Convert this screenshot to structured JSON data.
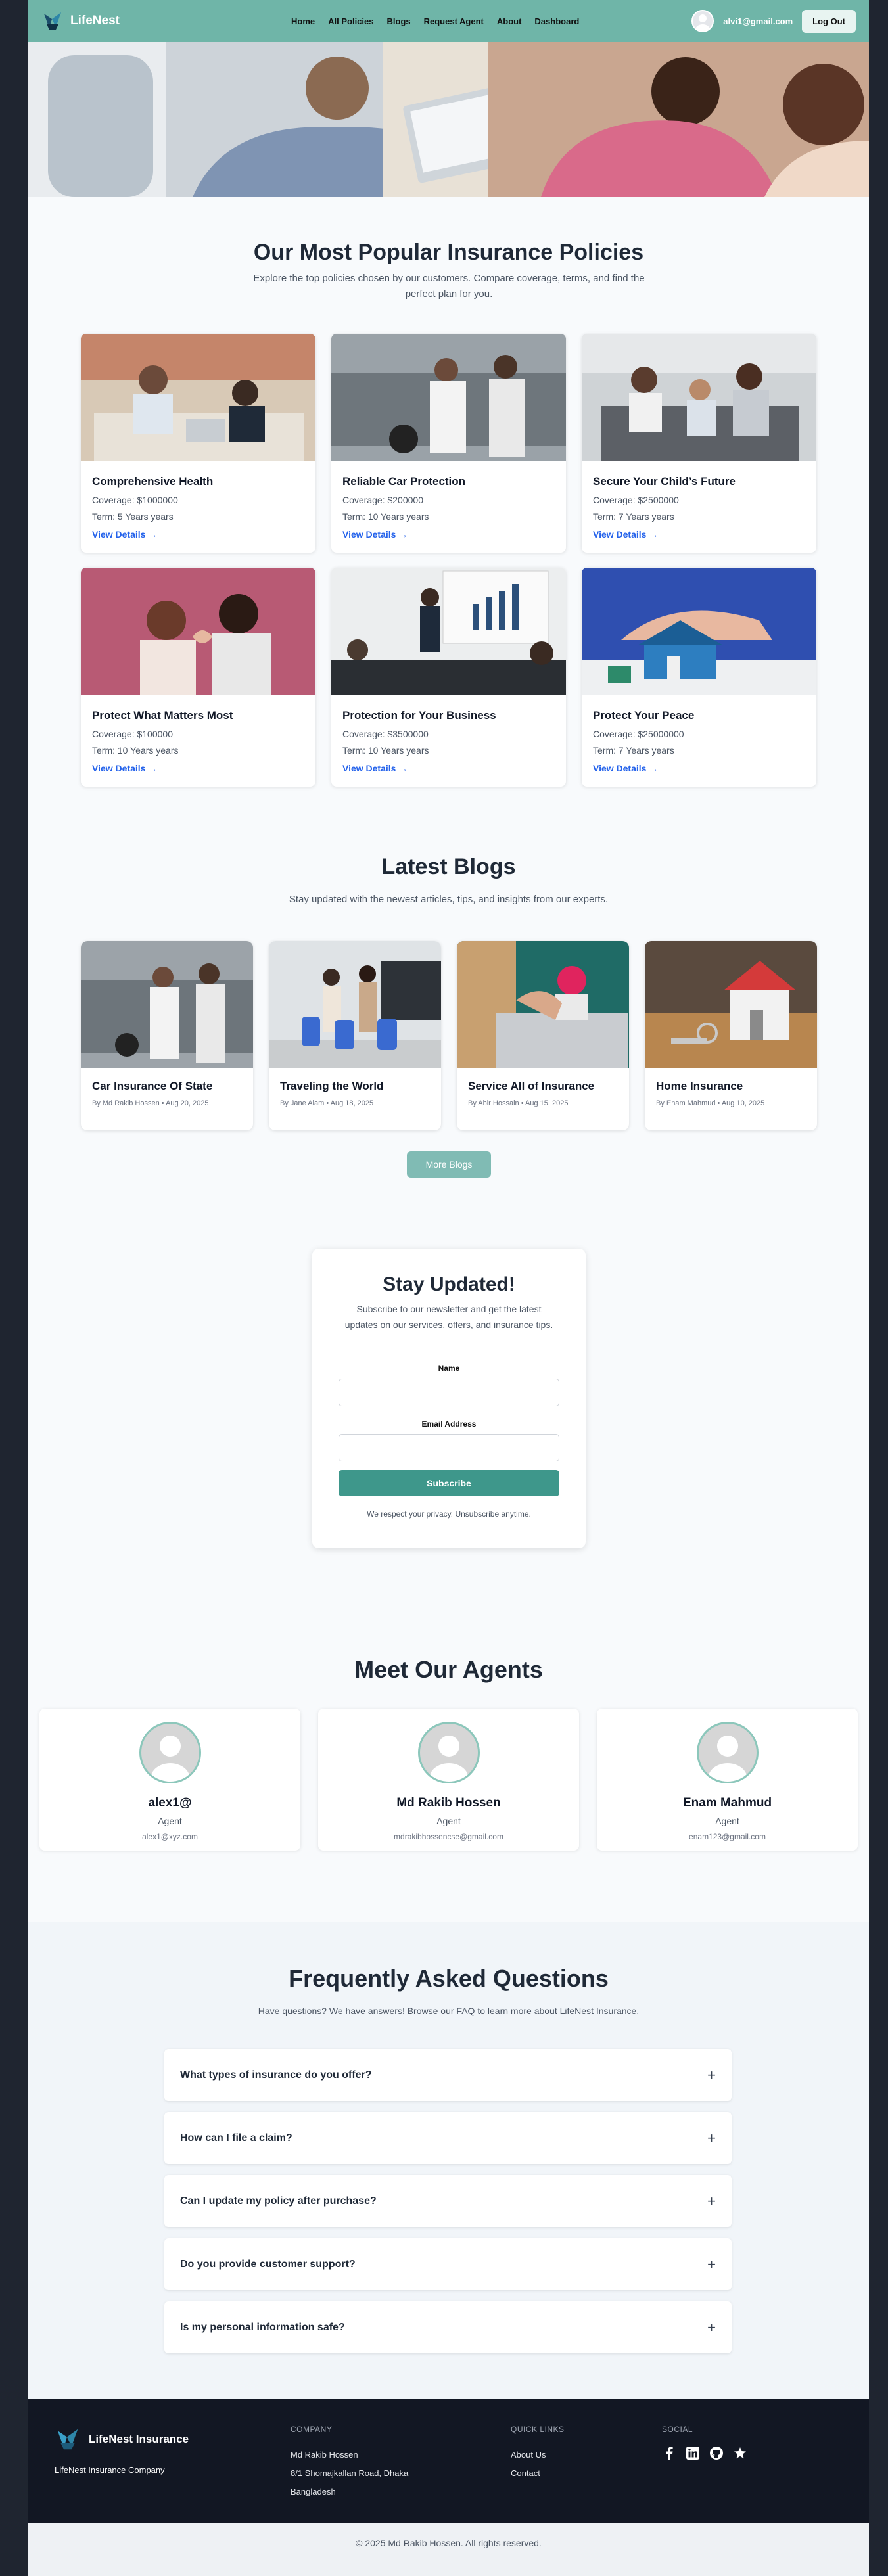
{
  "nav": {
    "brand": "LifeNest",
    "links": [
      "Home",
      "All Policies",
      "Blogs",
      "Request Agent",
      "About",
      "Dashboard"
    ],
    "user_email": "alvi1@gmail.com",
    "logout": "Log Out",
    "accent": "#6fb5a8"
  },
  "policies": {
    "title": "Our Most Popular Insurance Policies",
    "subtitle": "Explore the top policies chosen by our customers. Compare coverage, terms, and find the perfect plan for you.",
    "items": [
      {
        "title": "Comprehensive Health",
        "coverage": "Coverage: $1000000",
        "term": "Term: 5 Years years",
        "link": "View Details →"
      },
      {
        "title": "Reliable Car Protection",
        "coverage": "Coverage: $200000",
        "term": "Term: 10 Years years",
        "link": "View Details →"
      },
      {
        "title": "Secure Your Child’s Future",
        "coverage": "Coverage: $2500000",
        "term": "Term: 7 Years years",
        "link": "View Details →"
      },
      {
        "title": "Protect What Matters Most",
        "coverage": "Coverage: $100000",
        "term": "Term: 10 Years years",
        "link": "View Details →"
      },
      {
        "title": "Protection for Your Business",
        "coverage": "Coverage: $3500000",
        "term": "Term: 10 Years years",
        "link": "View Details →"
      },
      {
        "title": "Protect Your Peace",
        "coverage": "Coverage: $25000000",
        "term": "Term: 7 Years years",
        "link": "View Details →"
      }
    ]
  },
  "blogs": {
    "title": "Latest Blogs",
    "subtitle": "Stay updated with the newest articles, tips, and insights from our experts.",
    "items": [
      {
        "title": "Car Insurance Of State",
        "meta": "By Md Rakib Hossen • Aug 20, 2025"
      },
      {
        "title": "Traveling the World",
        "meta": "By Jane Alam • Aug 18, 2025"
      },
      {
        "title": "Service All of Insurance",
        "meta": "By Abir Hossain • Aug 15, 2025"
      },
      {
        "title": "Home Insurance",
        "meta": "By Enam Mahmud • Aug 10, 2025"
      }
    ],
    "more": "More Blogs"
  },
  "newsletter": {
    "title": "Stay Updated!",
    "subtitle": "Subscribe to our newsletter and get the latest updates on our services, offers, and insurance tips.",
    "name_label": "Name",
    "name_value": "",
    "email_label": "Email Address",
    "email_value": "",
    "button": "Subscribe",
    "privacy": "We respect your privacy. Unsubscribe anytime."
  },
  "agents": {
    "title": "Meet Our Agents",
    "items": [
      {
        "name": "alex1@",
        "role": "Agent",
        "email": "alex1@xyz.com"
      },
      {
        "name": "Md Rakib Hossen",
        "role": "Agent",
        "email": "mdrakibhossencse@gmail.com"
      },
      {
        "name": "Enam Mahmud",
        "role": "Agent",
        "email": "enam123@gmail.com"
      }
    ]
  },
  "faq": {
    "title": "Frequently Asked Questions",
    "subtitle": "Have questions? We have answers! Browse our FAQ to learn more about LifeNest Insurance.",
    "items": [
      "What types of insurance do you offer?",
      "How can I file a claim?",
      "Can I update my policy after purchase?",
      "Do you provide customer support?",
      "Is my personal information safe?"
    ],
    "expand_symbol": "+"
  },
  "footer": {
    "brand": "LifeNest Insurance",
    "tagline": "LifeNest Insurance Company",
    "company_head": "COMPANY",
    "company_lines": [
      "Md Rakib Hossen",
      "8/1 Shomajkallan Road, Dhaka",
      "Bangladesh"
    ],
    "quick_head": "QUICK LINKS",
    "quick_links": [
      "About Us",
      "Contact"
    ],
    "social_head": "SOCIAL",
    "social_icons": [
      "facebook-icon",
      "linkedin-icon",
      "github-icon",
      "star-icon"
    ],
    "copyright": "© 2025 Md Rakib Hossen. All rights reserved."
  }
}
